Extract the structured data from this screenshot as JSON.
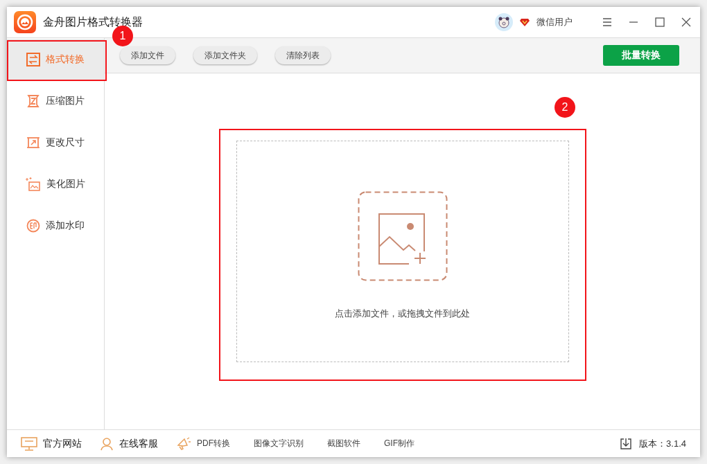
{
  "window": {
    "title": "金舟图片格式转换器"
  },
  "user": {
    "name": "微信用户"
  },
  "sidebar": {
    "items": [
      {
        "label": "格式转换",
        "selected": true
      },
      {
        "label": "压缩图片",
        "selected": false
      },
      {
        "label": "更改尺寸",
        "selected": false
      },
      {
        "label": "美化图片",
        "selected": false
      },
      {
        "label": "添加水印",
        "selected": false
      }
    ]
  },
  "toolbar": {
    "buttons": [
      "添加文件",
      "添加文件夹",
      "清除列表"
    ],
    "primary_button": "批量转换"
  },
  "drop_zone": {
    "hint": "点击添加文件，或拖拽文件到此处"
  },
  "footer": {
    "links": [
      {
        "label": "官方网站",
        "kind": "main"
      },
      {
        "label": "在线客服",
        "kind": "main"
      },
      {
        "label": "PDF转换",
        "kind": "promo"
      },
      {
        "label": "图像文字识别",
        "kind": "plain"
      },
      {
        "label": "截图软件",
        "kind": "plain"
      },
      {
        "label": "GIF制作",
        "kind": "plain"
      }
    ],
    "version": "版本：3.1.4"
  },
  "annotations": [
    {
      "number": "1"
    },
    {
      "number": "2"
    }
  ]
}
